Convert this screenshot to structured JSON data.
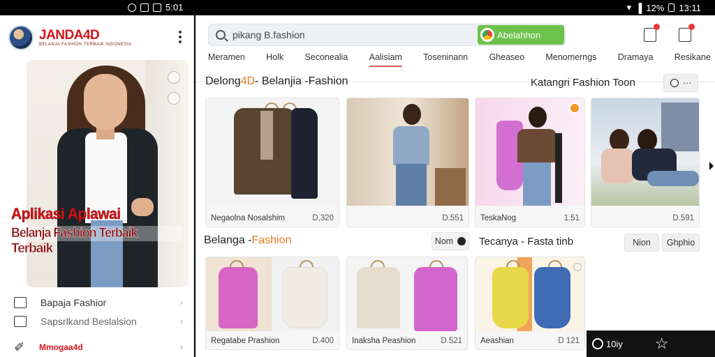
{
  "status_bar": {
    "left_time": "5:01",
    "battery": "12%",
    "right_time": "13:11"
  },
  "sidebar": {
    "brand": "JANDA4D",
    "tagline": "BELANJA FASHION TERBAIK INDONESIA",
    "promo_line1": "Aplikasi Aplawai",
    "promo_line2": "Belanja Fashion Terbaik",
    "promo_line3": "Terbaik",
    "menu": [
      {
        "label": "Bapaja Fashior",
        "icon": "wardrobe-icon"
      },
      {
        "label": "Sapsrlkand Beslalsion",
        "icon": "camera-icon"
      }
    ],
    "brand_link": "Mmogaa4d"
  },
  "header": {
    "search_query": "pikang B.fashion",
    "search_button": "Abelahhon",
    "tabs": [
      "Meramen",
      "Holk",
      "Seconealia",
      "Aalisiam",
      "Toseninann",
      "Gheaseo",
      "Menomerngs",
      "Dramaya",
      "Resikane"
    ],
    "active_tab": 3
  },
  "section1": {
    "title_pre": "Delong",
    "title_accent": "4D",
    "title_post": " - Belanjia -Fashion",
    "right_title": "Katangri Fashion Toon",
    "more_label": "···",
    "cards": [
      {
        "name": "Negaolna Nosalshim",
        "price": "D,320"
      },
      {
        "name": "",
        "price": "D.551"
      },
      {
        "name": "TeskaNog",
        "price": "1.51"
      },
      {
        "name": "",
        "price": "D.591"
      }
    ]
  },
  "section2": {
    "title_pre": "Belanga - ",
    "title_accent": "Fashion",
    "more_button": "Nom",
    "right_title": "Tecanya - Fasta tinb",
    "pill_1": "Nion",
    "pill_2": "Ghphio",
    "cards": [
      {
        "name": "Regatabe Prashion",
        "price": "D.400"
      },
      {
        "name": "Inaksha Peashion",
        "price": "D.521"
      },
      {
        "name": "Aeashian",
        "price": "D 121"
      }
    ]
  },
  "bottom_bar": {
    "label": "10iy"
  },
  "colors": {
    "brand_red": "#d4141b",
    "accent_orange": "#e67e22",
    "search_green": "#6cc24a"
  }
}
